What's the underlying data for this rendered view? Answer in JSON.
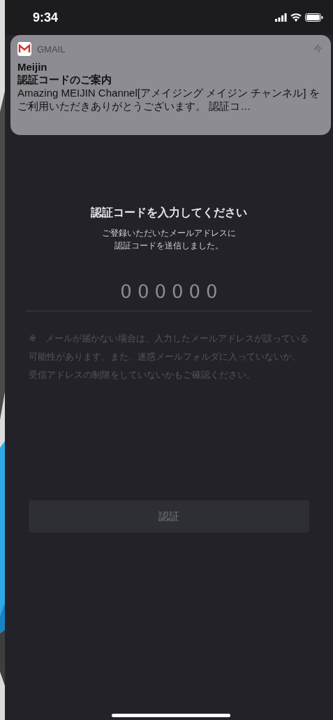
{
  "status_bar": {
    "time": "9:34"
  },
  "notification": {
    "app": "GMAIL",
    "time": "今",
    "sender": "Meijin",
    "subject": "認証コードのご案内",
    "body": "Amazing MEIJIN Channel[アメイジング メイジン チャンネル] をご利用いただきありがとうございます。 認証コ…"
  },
  "title": "認証コードを入力してください",
  "subtitle_lines": [
    "ご登録いただいたメールアドレスに",
    "認証コードを送信しました。"
  ],
  "code_field": {
    "placeholder": "000000"
  },
  "note": "※　メールが届かない場合は、入力したメールアドレスが誤っている可能性があります。また、迷惑メールフォルダに入っていないか、受信アドレスの制限をしていないかもご確認ください。",
  "verify_button": {
    "label": "認証",
    "disabled": true
  }
}
